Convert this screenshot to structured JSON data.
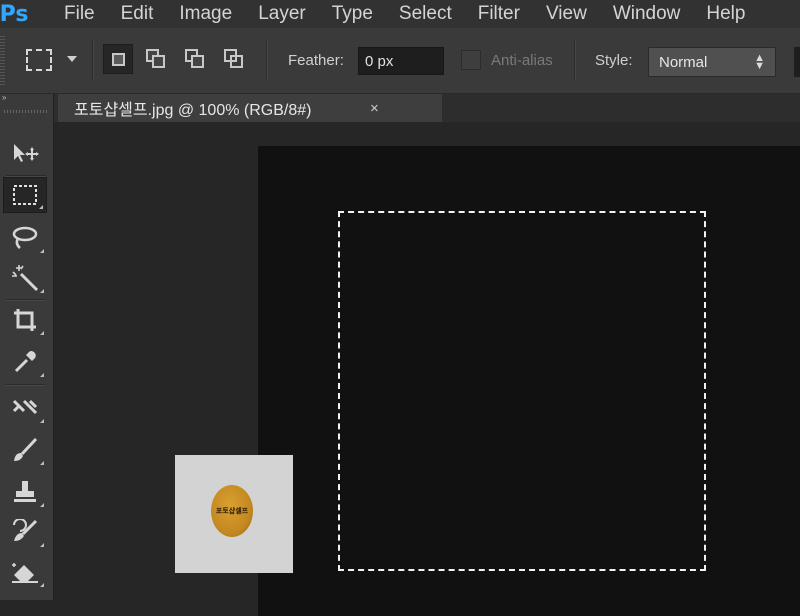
{
  "app": {
    "logo": "Ps"
  },
  "menu": [
    "File",
    "Edit",
    "Image",
    "Layer",
    "Type",
    "Select",
    "Filter",
    "View",
    "Window",
    "Help"
  ],
  "options": {
    "feather_label": "Feather:",
    "feather_value": "0 px",
    "antialias_label": "Anti-alias",
    "style_label": "Style:",
    "style_value": "Normal"
  },
  "toolbox": {
    "collapse_glyph": "»",
    "tools": [
      "move-tool-icon",
      "rectangular-marquee-icon",
      "lasso-icon",
      "magic-wand-icon",
      "crop-icon",
      "eyedropper-icon",
      "healing-brush-icon",
      "brush-icon",
      "clone-stamp-icon",
      "history-brush-icon",
      "eraser-icon"
    ]
  },
  "document": {
    "tab_title": "포토샵셀프.jpg @ 100% (RGB/8#)",
    "close_glyph": "×",
    "thumbnail_text": "포토샵셀프"
  },
  "colors": {
    "menubar": "#323232",
    "optionsbar": "#3a3a3a",
    "workspace": "#262626",
    "canvas": "#111111",
    "ps_blue": "#31a8ff"
  }
}
